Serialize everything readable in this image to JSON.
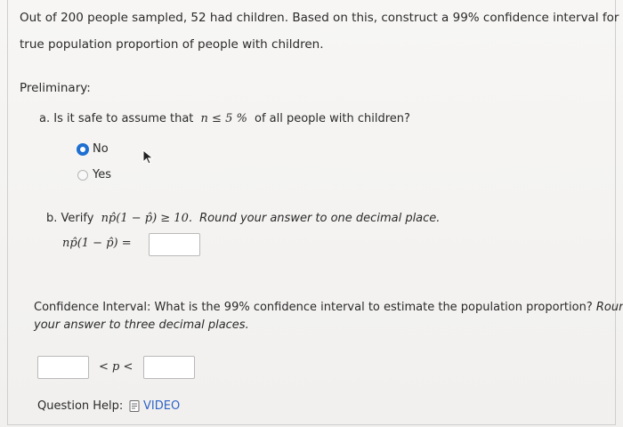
{
  "question": {
    "prompt_line1": "Out of 200 people sampled, 52 had children. Based on this, construct a 99% confidence interval for the",
    "prompt_line2": "true population proportion of people with children."
  },
  "preliminary": {
    "heading": "Preliminary:",
    "part_a": {
      "marker": "a.",
      "text_before": "Is it safe to assume that",
      "math": "n ≤ 5 %",
      "text_after": "of all people with children?",
      "options": [
        {
          "label": "No",
          "selected": true
        },
        {
          "label": "Yes",
          "selected": false
        }
      ]
    },
    "part_b": {
      "marker": "b.",
      "verify_text": "Verify",
      "math": "np̂(1 − p̂) ≥ 10.",
      "instruction": "Round your answer to one decimal place.",
      "equation_label": "np̂(1 − p̂) ="
    }
  },
  "confidence_interval": {
    "label": "Confidence Interval:",
    "question": "What is the 99% confidence interval to estimate the population proportion?",
    "instruction_part1": "Round",
    "instruction_part2": "your answer to three decimal places.",
    "middle": "< p <"
  },
  "help": {
    "label": "Question Help:",
    "icon": "document-icon",
    "video_label": "VIDEO"
  },
  "colors": {
    "accent": "#1f6fd1",
    "link": "#2d63c8",
    "text": "#2a2a2a"
  }
}
